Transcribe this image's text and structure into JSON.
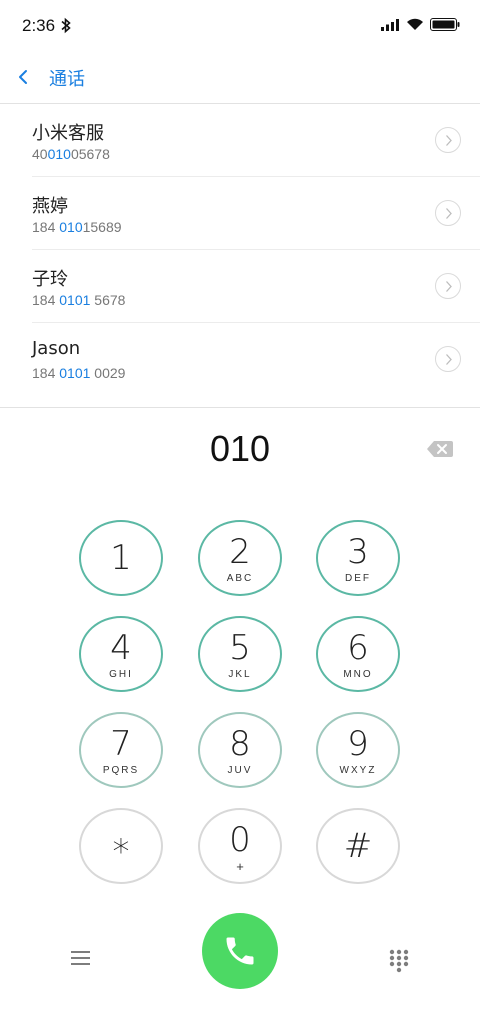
{
  "status_bar": {
    "time": "2:36",
    "bluetooth_icon": "bluetooth-icon",
    "signal_icon": "signal-icon",
    "wifi_icon": "wifi-icon",
    "battery_icon": "battery-icon"
  },
  "header": {
    "back_icon": "chevron-left-icon",
    "title": "通话"
  },
  "contacts": [
    {
      "name": "小米客服",
      "number_before": "40",
      "number_match": "010",
      "number_after": "05678"
    },
    {
      "name": "燕婷",
      "number_before": "184 ",
      "number_match": "010",
      "number_after": "15689"
    },
    {
      "name": "子玲",
      "number_before": "184 ",
      "number_match": "0101",
      "number_after": " 5678"
    },
    {
      "name": "Jason",
      "number_before": "184 ",
      "number_match": "0101",
      "number_after": " 0029"
    }
  ],
  "dialer": {
    "input": "010",
    "delete_icon": "backspace-icon"
  },
  "keypad": {
    "keys": [
      {
        "digit": "1",
        "letters": ""
      },
      {
        "digit": "2",
        "letters": "ABC"
      },
      {
        "digit": "3",
        "letters": "DEF"
      },
      {
        "digit": "4",
        "letters": "GHI"
      },
      {
        "digit": "5",
        "letters": "JKL"
      },
      {
        "digit": "6",
        "letters": "MNO"
      },
      {
        "digit": "7",
        "letters": "PQRS"
      },
      {
        "digit": "8",
        "letters": "JUV"
      },
      {
        "digit": "9",
        "letters": "WXYZ"
      },
      {
        "digit": "*",
        "letters": ""
      },
      {
        "digit": "0",
        "letters": "+"
      },
      {
        "digit": "#",
        "letters": ""
      }
    ]
  },
  "bottom_bar": {
    "menu_icon": "menu-icon",
    "call_icon": "phone-icon",
    "keypad_icon": "keypad-grid-icon"
  },
  "colors": {
    "accent": "#1a7fe0",
    "call_green": "#4cd964",
    "key_ring": "#5bb8a4"
  }
}
